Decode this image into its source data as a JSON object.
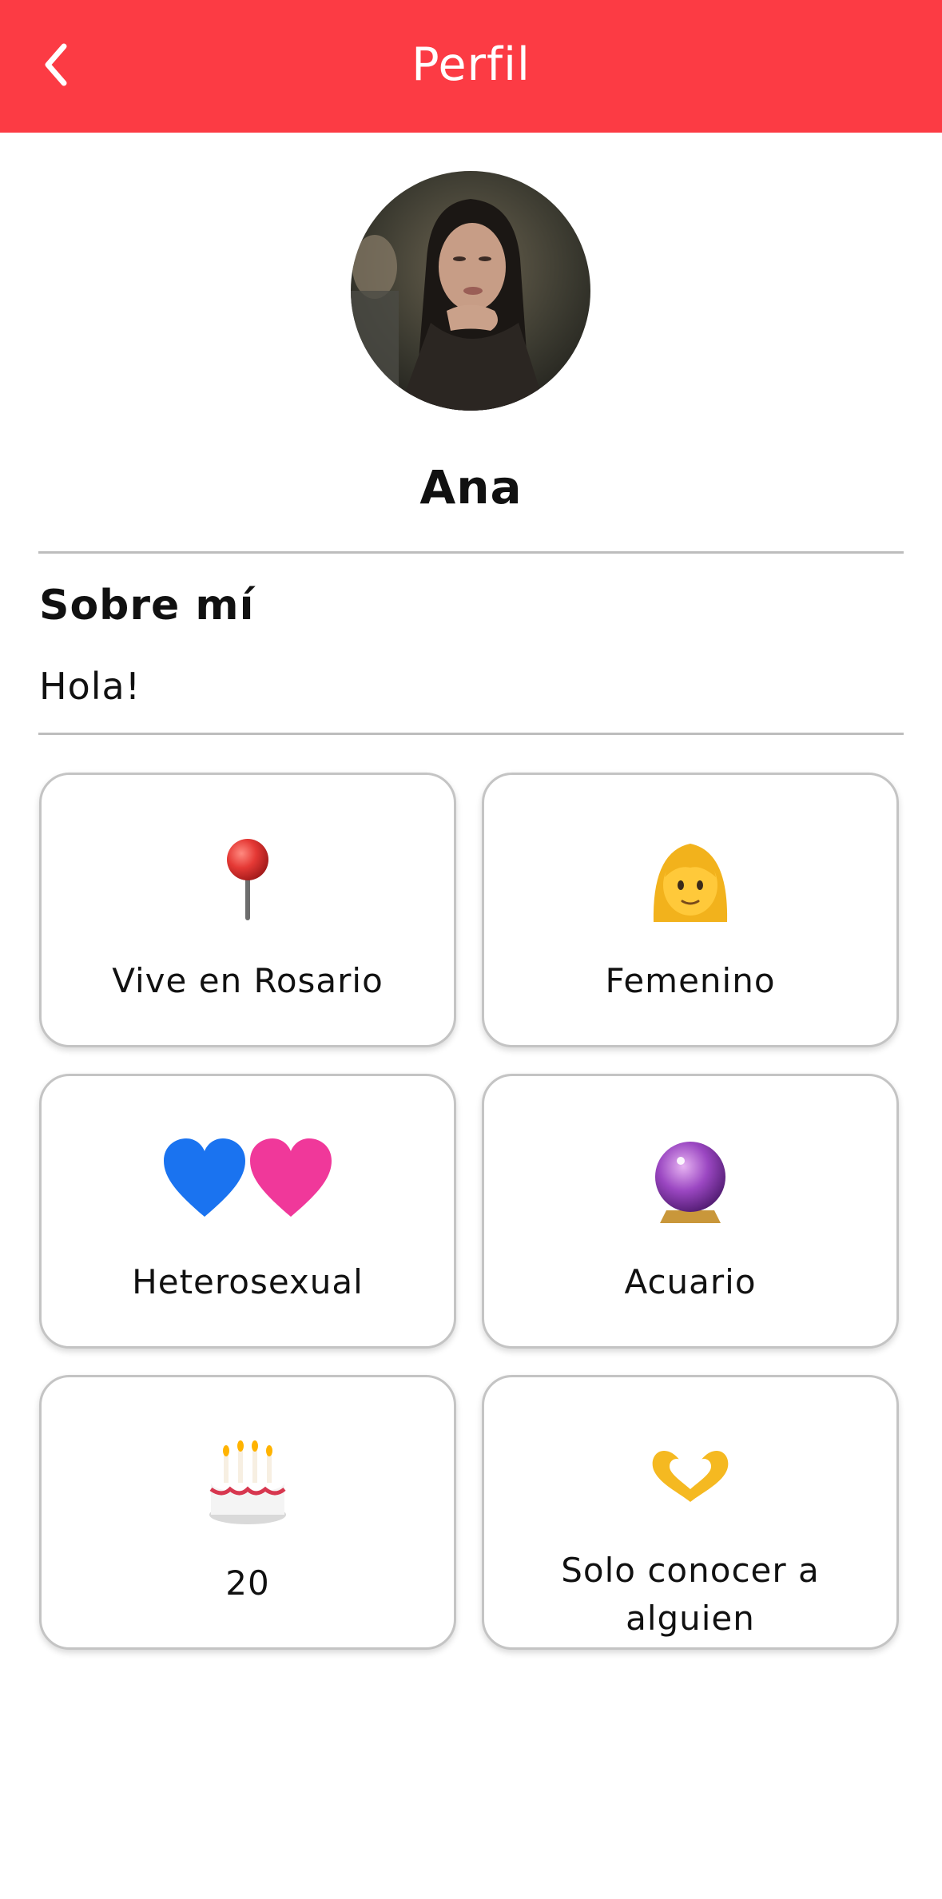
{
  "header": {
    "title": "Perfil",
    "background_color": "#fc3b44",
    "back_icon": "chevron-left-icon"
  },
  "profile": {
    "name": "Ana",
    "avatar_icon": "profile-photo"
  },
  "about": {
    "title": "Sobre mí",
    "text": "Hola!"
  },
  "cards": [
    {
      "icon": "pushpin-icon",
      "label": "Vive en Rosario"
    },
    {
      "icon": "woman-icon",
      "label": "Femenino"
    },
    {
      "icon": "blue-pink-hearts-icon",
      "label": "Heterosexual"
    },
    {
      "icon": "crystal-ball-icon",
      "label": "Acuario"
    },
    {
      "icon": "birthday-cake-icon",
      "label": "20"
    },
    {
      "icon": "heart-hands-icon",
      "label": "Solo conocer a alguien"
    }
  ]
}
